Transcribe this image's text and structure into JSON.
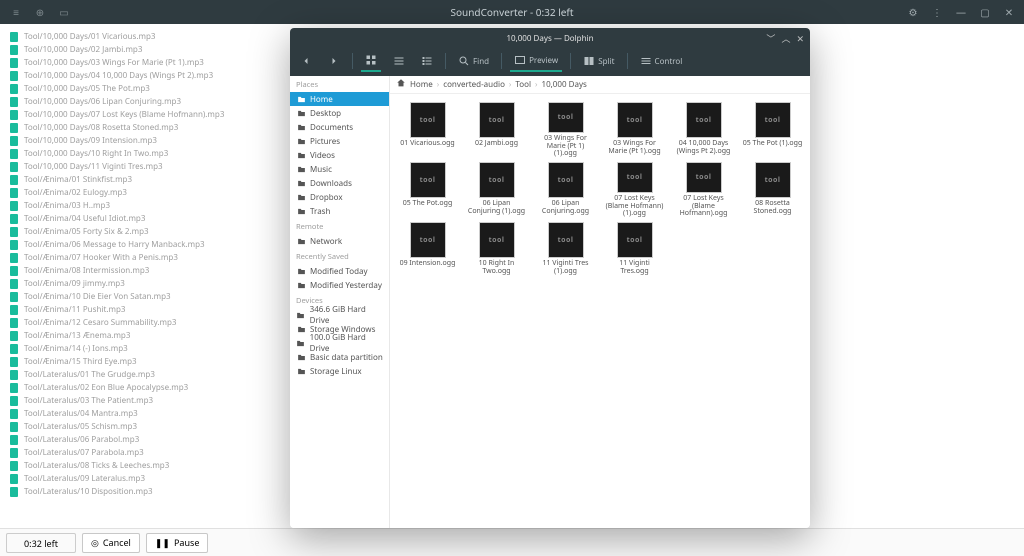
{
  "window": {
    "title": "SoundConverter - 0:32 left",
    "gear_tip": "Settings",
    "menu_tip": "Menu",
    "min_tip": "Minimize",
    "max_tip": "Maximize",
    "close_tip": "Close"
  },
  "soundconverter": {
    "time_left": "0:32 left",
    "cancel_label": "Cancel",
    "pause_label": "Pause",
    "queue": [
      "Tool/10,000 Days/01 Vicarious.mp3",
      "Tool/10,000 Days/02 Jambi.mp3",
      "Tool/10,000 Days/03 Wings For Marie (Pt 1).mp3",
      "Tool/10,000 Days/04 10,000 Days (Wings Pt 2).mp3",
      "Tool/10,000 Days/05 The Pot.mp3",
      "Tool/10,000 Days/06 Lipan Conjuring.mp3",
      "Tool/10,000 Days/07 Lost Keys (Blame Hofmann).mp3",
      "Tool/10,000 Days/08 Rosetta Stoned.mp3",
      "Tool/10,000 Days/09 Intension.mp3",
      "Tool/10,000 Days/10 Right In Two.mp3",
      "Tool/10,000 Days/11 Viginti Tres.mp3",
      "Tool/Ænima/01 Stinkfist.mp3",
      "Tool/Ænima/02 Eulogy.mp3",
      "Tool/Ænima/03 H..mp3",
      "Tool/Ænima/04 Useful Idiot.mp3",
      "Tool/Ænima/05 Forty Six & 2.mp3",
      "Tool/Ænima/06 Message to Harry Manback.mp3",
      "Tool/Ænima/07 Hooker With a Penis.mp3",
      "Tool/Ænima/08 Intermission.mp3",
      "Tool/Ænima/09 jimmy.mp3",
      "Tool/Ænima/10 Die Eier Von Satan.mp3",
      "Tool/Ænima/11 Pushit.mp3",
      "Tool/Ænima/12 Cesaro Summability.mp3",
      "Tool/Ænima/13 Ænema.mp3",
      "Tool/Ænima/14 (-) Ions.mp3",
      "Tool/Ænima/15 Third Eye.mp3",
      "Tool/Lateralus/01 The Grudge.mp3",
      "Tool/Lateralus/02 Eon Blue Apocalypse.mp3",
      "Tool/Lateralus/03 The Patient.mp3",
      "Tool/Lateralus/04 Mantra.mp3",
      "Tool/Lateralus/05 Schism.mp3",
      "Tool/Lateralus/06 Parabol.mp3",
      "Tool/Lateralus/07 Parabola.mp3",
      "Tool/Lateralus/08 Ticks & Leeches.mp3",
      "Tool/Lateralus/09 Lateralus.mp3",
      "Tool/Lateralus/10 Disposition.mp3"
    ]
  },
  "dolphin": {
    "title": "10,000 Days — Dolphin",
    "toolbar": {
      "back": "Back",
      "forward": "Forward",
      "icons": "Icons",
      "compact": "Compact",
      "details": "Details",
      "find": "Find",
      "preview": "Preview",
      "split": "Split",
      "control": "Control"
    },
    "breadcrumb": [
      "Home",
      "converted-audio",
      "Tool",
      "10,000 Days"
    ],
    "places_label": "Places",
    "places": [
      {
        "label": "Home",
        "icon": "home",
        "active": true
      },
      {
        "label": "Desktop",
        "icon": "desktop"
      },
      {
        "label": "Documents",
        "icon": "documents"
      },
      {
        "label": "Pictures",
        "icon": "pictures"
      },
      {
        "label": "Videos",
        "icon": "videos"
      },
      {
        "label": "Music",
        "icon": "music"
      },
      {
        "label": "Downloads",
        "icon": "downloads"
      },
      {
        "label": "Dropbox",
        "icon": "dropbox"
      },
      {
        "label": "Trash",
        "icon": "trash"
      }
    ],
    "remote_label": "Remote",
    "remote": [
      {
        "label": "Network",
        "icon": "network"
      }
    ],
    "recent_label": "Recently Saved",
    "recent": [
      {
        "label": "Modified Today",
        "icon": "today"
      },
      {
        "label": "Modified Yesterday",
        "icon": "yesterday"
      }
    ],
    "devices_label": "Devices",
    "devices": [
      {
        "label": "346.6 GiB Hard Drive",
        "icon": "hdd"
      },
      {
        "label": "Storage Windows",
        "icon": "hdd"
      },
      {
        "label": "100.0 GiB Hard Drive",
        "icon": "hdd"
      },
      {
        "label": "Basic data partition",
        "icon": "hdd"
      },
      {
        "label": "Storage Linux",
        "icon": "hdd"
      }
    ],
    "files": [
      "01 Vicarious.ogg",
      "02 Jambi.ogg",
      "03 Wings For Marie (Pt 1) (1).ogg",
      "03 Wings For Marie (Pt 1).ogg",
      "04 10,000 Days (Wings Pt 2).ogg",
      "05 The Pot (1).ogg",
      "05 The Pot.ogg",
      "06 Lipan Conjuring (1).ogg",
      "06 Lipan Conjuring.ogg",
      "07 Lost Keys (Blame Hofmann) (1).ogg",
      "07 Lost Keys (Blame Hofmann).ogg",
      "08 Rosetta Stoned.ogg",
      "09 Intension.ogg",
      "10 Right In Two.ogg",
      "11 Viginti Tres (1).ogg",
      "11 Viginti Tres.ogg"
    ]
  }
}
